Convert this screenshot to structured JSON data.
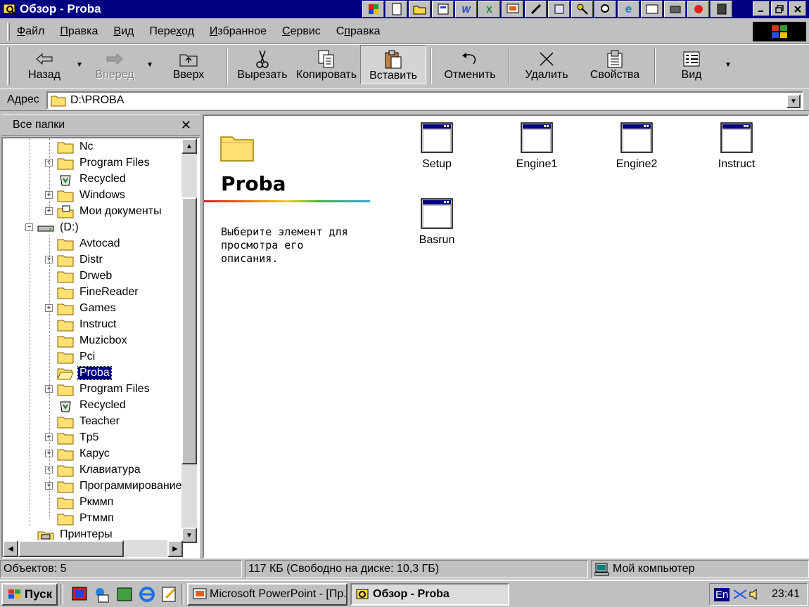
{
  "window": {
    "title": "Обзор - Proba"
  },
  "menu": {
    "items": [
      {
        "label": "Файл",
        "accel": "Ф",
        "rest": "айл"
      },
      {
        "label": "Правка",
        "accel": "П",
        "rest": "равка"
      },
      {
        "label": "Вид",
        "accel": "В",
        "rest": "ид"
      },
      {
        "label": "Переход",
        "pre": "Пере",
        "accel": "х",
        "rest": "од"
      },
      {
        "label": "Избранное",
        "accel": "И",
        "rest": "збранное"
      },
      {
        "label": "Сервис",
        "accel": "С",
        "rest": "ервис"
      },
      {
        "label": "Справка",
        "pre": "С",
        "accel": "п",
        "rest": "равка"
      }
    ]
  },
  "toolbar": {
    "back": "Назад",
    "forward": "Вперед",
    "up": "Вверх",
    "cut": "Вырезать",
    "copy": "Копировать",
    "paste": "Вставить",
    "undo": "Отменить",
    "delete": "Удалить",
    "properties": "Свойства",
    "view": "Вид"
  },
  "address": {
    "label": "Адрес",
    "value": "D:\\PROBA"
  },
  "tree": {
    "header": "Все папки",
    "items": [
      {
        "label": "Nc",
        "icon": "folder-icon",
        "expand": false
      },
      {
        "label": "Program Files",
        "icon": "folder-icon",
        "expand": true
      },
      {
        "label": "Recycled",
        "icon": "recycle-bin-icon",
        "expand": false
      },
      {
        "label": "Windows",
        "icon": "folder-icon",
        "expand": true
      },
      {
        "label": "Мои документы",
        "icon": "my-documents-icon",
        "expand": true
      },
      {
        "label": "(D:)",
        "icon": "drive-icon",
        "expand": true,
        "expanded": true
      },
      {
        "label": "Avtocad",
        "icon": "folder-icon",
        "expand": false
      },
      {
        "label": "Distr",
        "icon": "folder-icon",
        "expand": true
      },
      {
        "label": "Drweb",
        "icon": "folder-icon",
        "expand": false
      },
      {
        "label": "FineReader",
        "icon": "folder-icon",
        "expand": false
      },
      {
        "label": "Games",
        "icon": "folder-icon",
        "expand": true
      },
      {
        "label": "Instruct",
        "icon": "folder-icon",
        "expand": false
      },
      {
        "label": "Muzicbox",
        "icon": "folder-icon",
        "expand": false
      },
      {
        "label": "Pci",
        "icon": "folder-icon",
        "expand": false
      },
      {
        "label": "Proba",
        "icon": "open-folder-icon",
        "expand": false,
        "selected": true
      },
      {
        "label": "Program Files",
        "icon": "folder-icon",
        "expand": true
      },
      {
        "label": "Recycled",
        "icon": "recycle-bin-icon",
        "expand": false
      },
      {
        "label": "Teacher",
        "icon": "folder-icon",
        "expand": false
      },
      {
        "label": "Tp5",
        "icon": "folder-icon",
        "expand": true
      },
      {
        "label": "Карус",
        "icon": "folder-icon",
        "expand": true
      },
      {
        "label": "Клавиатура",
        "icon": "folder-icon",
        "expand": true
      },
      {
        "label": "Программирование",
        "icon": "folder-icon",
        "expand": true
      },
      {
        "label": "Ркммп",
        "icon": "folder-icon",
        "expand": false
      },
      {
        "label": "Ртммп",
        "icon": "folder-icon",
        "expand": false
      },
      {
        "label": "Принтеры",
        "icon": "printers-icon",
        "expand": false
      }
    ]
  },
  "content": {
    "folder_name": "Proba",
    "description": "Выберите элемент для просмотра его описания.",
    "files": [
      {
        "name": "Setup",
        "icon": "application-window-icon"
      },
      {
        "name": "Engine1",
        "icon": "application-window-icon"
      },
      {
        "name": "Engine2",
        "icon": "application-window-icon"
      },
      {
        "name": "Instruct",
        "icon": "application-window-icon"
      },
      {
        "name": "Basrun",
        "icon": "application-window-icon"
      }
    ]
  },
  "status": {
    "objects": "Объектов: 5",
    "size": "117 КБ (Свободно на диске: 10,3 ГБ)",
    "location": "Мой компьютер"
  },
  "taskbar": {
    "start": "Пуск",
    "tasks": [
      {
        "label": "Microsoft PowerPoint - [Пр..."
      },
      {
        "label": "Обзор - Proba"
      }
    ],
    "lang": "En",
    "clock": "23:41"
  },
  "colors": {
    "title_bar": "#000080",
    "face": "#c0c0c0",
    "selection": "#000080"
  }
}
